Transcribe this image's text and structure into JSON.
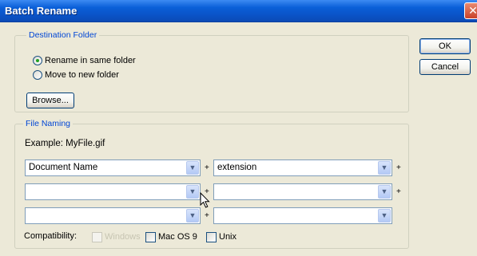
{
  "window": {
    "title": "Batch Rename",
    "close_glyph": "✕"
  },
  "actions": {
    "ok_label": "OK",
    "cancel_label": "Cancel"
  },
  "destination": {
    "legend": "Destination Folder",
    "options": [
      {
        "label": "Rename in same folder",
        "checked": true
      },
      {
        "label": "Move to new folder",
        "checked": false
      }
    ],
    "browse_label": "Browse..."
  },
  "file_naming": {
    "legend": "File Naming",
    "example": "Example: MyFile.gif",
    "rows": [
      {
        "left": "Document Name",
        "right": "extension"
      },
      {
        "left": "",
        "right": ""
      },
      {
        "left": "",
        "right": ""
      }
    ],
    "separator": "+",
    "compatibility": {
      "label": "Compatibility:",
      "windows": {
        "label": "Windows",
        "checked": true,
        "disabled": true
      },
      "mac": {
        "label": "Mac OS 9",
        "checked": false
      },
      "unix": {
        "label": "Unix",
        "checked": false
      }
    }
  },
  "icons": {
    "dropdown": "chevron-down-icon",
    "cursor": "mouse-pointer-icon"
  },
  "colors": {
    "title_bar": "#0a5fd8",
    "legend": "#0046d5",
    "face": "#ece9d8"
  }
}
